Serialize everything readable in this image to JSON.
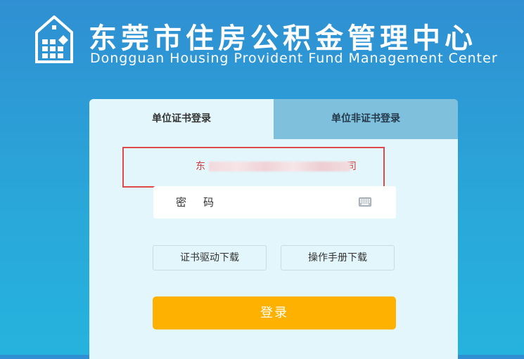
{
  "header": {
    "title_cn": "东莞市住房公积金管理中心",
    "title_en": "Dongguan Housing Provident Fund Management Center",
    "logo_icon": "house-building-icon"
  },
  "login_card": {
    "tabs": [
      {
        "label": "单位证书登录",
        "active": true
      },
      {
        "label": "单位非证书登录",
        "active": false
      }
    ],
    "company_field": {
      "visible_prefix": "东",
      "visible_suffix": "司"
    },
    "password": {
      "label": "密码",
      "value": "",
      "keyboard_icon": "keyboard-icon"
    },
    "buttons": {
      "driver_download": "证书驱动下载",
      "manual_download": "操作手册下载",
      "login": "登录"
    }
  },
  "colors": {
    "background_top": "#2f8fd2",
    "background_bottom": "#25b3dd",
    "card": "#e3f6fb",
    "inactive_tab": "#7fc0dd",
    "login_button": "#ffb100",
    "highlight_border": "#e34848",
    "company_text": "#d03c3c"
  }
}
